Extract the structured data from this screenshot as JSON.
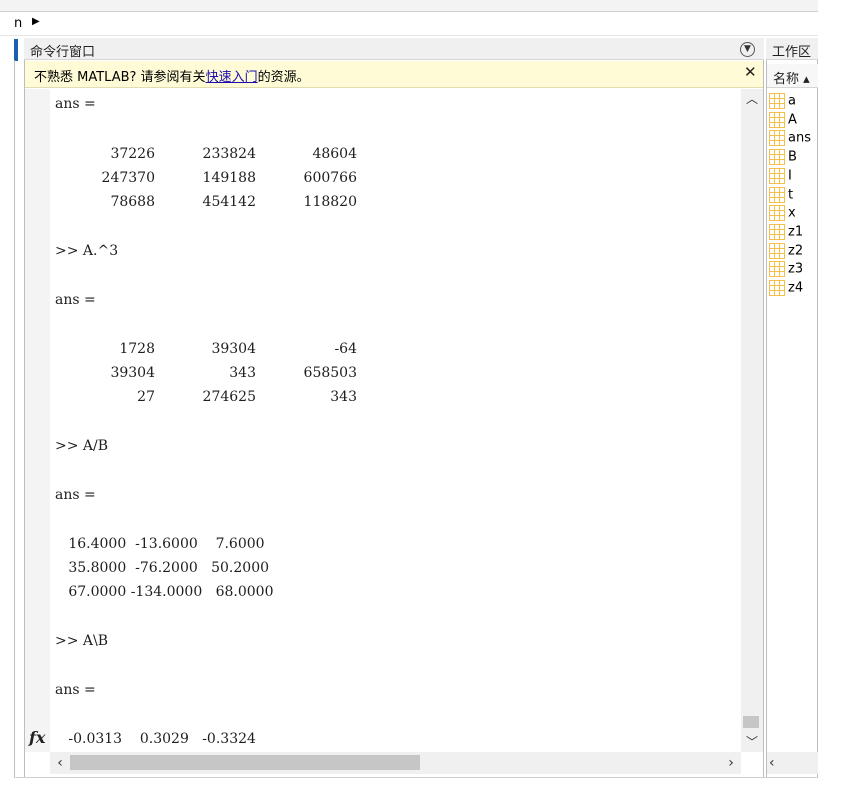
{
  "path_bar": {
    "text": "n",
    "arrow": "▶"
  },
  "command_window": {
    "title": "命令行窗口",
    "notice": {
      "prefix": "不熟悉 MATLAB? 请参阅有关",
      "link": "快速入门",
      "suffix": "的资源。",
      "close": "✕"
    },
    "lines": [
      {
        "text": "ans ="
      },
      {
        "row": [
          "37226",
          "233824",
          "48604"
        ]
      },
      {
        "row": [
          "247370",
          "149188",
          "600766"
        ]
      },
      {
        "row": [
          "78688",
          "454142",
          "118820"
        ]
      },
      {
        "text": ">> A.^3"
      },
      {
        "text": "ans ="
      },
      {
        "row": [
          "1728",
          "39304",
          "-64"
        ]
      },
      {
        "row": [
          "39304",
          "343",
          "658503"
        ]
      },
      {
        "row": [
          "27",
          "274625",
          "343"
        ]
      },
      {
        "text": ">> A/B"
      },
      {
        "text": "ans ="
      },
      {
        "text": "   16.4000  -13.6000    7.6000"
      },
      {
        "text": "   35.8000  -76.2000   50.2000"
      },
      {
        "text": "   67.0000 -134.0000   68.0000"
      },
      {
        "text": ">> A\\B"
      },
      {
        "text": "ans ="
      },
      {
        "text": "   -0.0313    0.3029   -0.3324"
      }
    ],
    "prompt_icon": "fx"
  },
  "workspace": {
    "title": "工作区",
    "column_header": "名称 ▴",
    "variables": [
      "a",
      "A",
      "ans",
      "B",
      "I",
      "t",
      "x",
      "z1",
      "z2",
      "z3",
      "z4"
    ]
  },
  "colors": {
    "notice_bg": "#fffbd6",
    "link": "#1a0dab",
    "accent": "#1a5fb4",
    "var_icon": "#f3c04a"
  }
}
